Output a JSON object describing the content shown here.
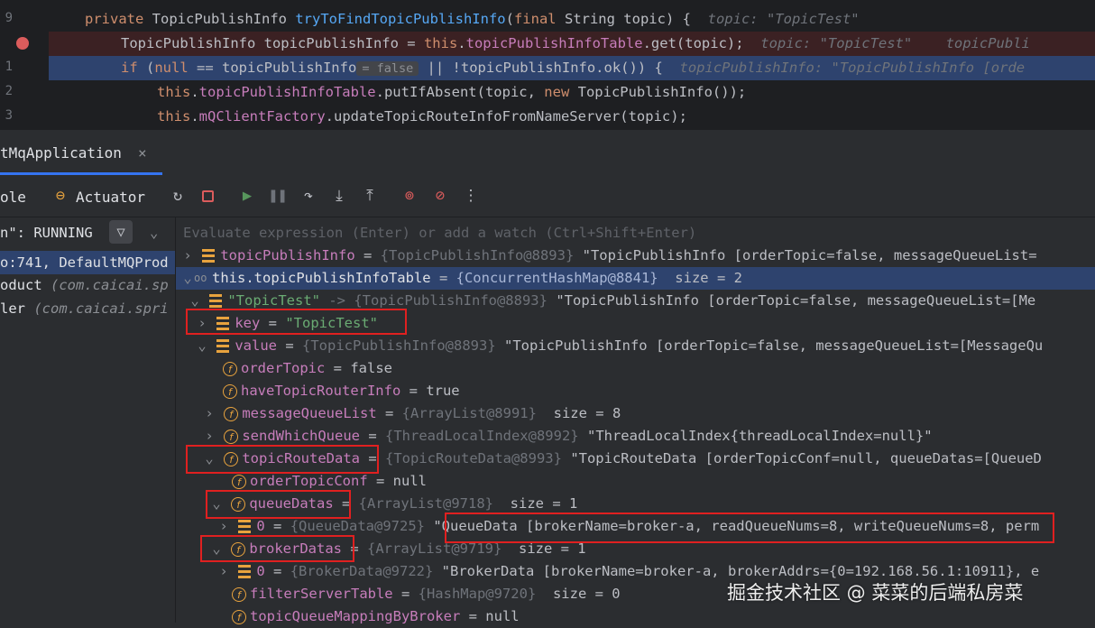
{
  "editor": {
    "line_numbers": [
      "9",
      "",
      "1",
      "2",
      "3"
    ],
    "line1": {
      "kw": "private",
      "type": "TopicPublishInfo",
      "method": "tryToFindTopicPublishInfo",
      "params_kw": "final",
      "params": "String topic) {",
      "hint": "topic: \"TopicTest\""
    },
    "line2": {
      "decl": "TopicPublishInfo topicPublishInfo = ",
      "this_kw": "this",
      "field": "topicPublishInfoTable",
      "call": ".get(topic);",
      "hint1": "topic: \"TopicTest\"",
      "hint2": "topicPubli"
    },
    "line3": {
      "kw": "if",
      "open": " (",
      "null_kw": "null",
      "cmp": " == topicPublishInfo",
      "inlay": "= false",
      "rest": " || !topicPublishInfo.ok()) {",
      "hint": "topicPublishInfo: \"TopicPublishInfo [orde"
    },
    "line4": {
      "this_kw": "this",
      "field": "topicPublishInfoTable",
      "call": ".putIfAbsent(topic, ",
      "new_kw": "new",
      "rest": " TopicPublishInfo());"
    },
    "line5": {
      "this_kw": "this",
      "field": "mQClientFactory",
      "call": ".updateTopicRouteInfoFromNameServer(topic);"
    }
  },
  "run_tab": {
    "label": "tMqApplication",
    "close": "×"
  },
  "toolbar": {
    "console_label": "ole",
    "actuator_label": "Actuator",
    "more": "⋮"
  },
  "frames": {
    "thread_status": "n\": RUNNING",
    "items": [
      {
        "main": "o:741, DefaultMQProd",
        "pkg": ""
      },
      {
        "main": "oduct ",
        "pkg": "(com.caicai.sp"
      },
      {
        "main": "ler ",
        "pkg": "(com.caicai.spri"
      }
    ]
  },
  "watch_placeholder": "Evaluate expression (Enter) or add a watch (Ctrl+Shift+Enter)",
  "variables": [
    {
      "name": "topicPublishInfo",
      "type": "{TopicPublishInfo@8893}",
      "value": "\"TopicPublishInfo [orderTopic=false, messageQueueList="
    },
    {
      "name": "this.topicPublishInfoTable",
      "type": "{ConcurrentHashMap@8841}",
      "value": " size = 2"
    },
    {
      "name": "\"TopicTest\"",
      "type": "-> {TopicPublishInfo@8893}",
      "value": "\"TopicPublishInfo [orderTopic=false, messageQueueList=[Me"
    },
    {
      "name": "key",
      "eq": " = ",
      "value": "\"TopicTest\""
    },
    {
      "name": "value",
      "type": "{TopicPublishInfo@8893}",
      "value": "\"TopicPublishInfo [orderTopic=false, messageQueueList=[MessageQu"
    },
    {
      "name": "orderTopic",
      "value": "false"
    },
    {
      "name": "haveTopicRouterInfo",
      "value": "true"
    },
    {
      "name": "messageQueueList",
      "type": "{ArrayList@8991}",
      "value": " size = 8"
    },
    {
      "name": "sendWhichQueue",
      "type": "{ThreadLocalIndex@8992}",
      "value": "\"ThreadLocalIndex{threadLocalIndex=null}\""
    },
    {
      "name": "topicRouteData",
      "type": "{TopicRouteData@8993}",
      "value": "\"TopicRouteData [orderTopicConf=null, queueDatas=[QueueD"
    },
    {
      "name": "orderTopicConf",
      "value": "null"
    },
    {
      "name": "queueDatas",
      "type": "{ArrayList@9718}",
      "value": " size = 1"
    },
    {
      "name": "0",
      "type": "{QueueData@9725}",
      "value": "\"QueueData [brokerName=broker-a, readQueueNums=8, writeQueueNums=8, perm"
    },
    {
      "name": "brokerDatas",
      "type": "{ArrayList@9719}",
      "value": " size = 1"
    },
    {
      "name": "0",
      "type": "{BrokerData@9722}",
      "value": "\"BrokerData [brokerName=broker-a, brokerAddrs={0=192.168.56.1:10911}, e"
    },
    {
      "name": "filterServerTable",
      "type": "{HashMap@9720}",
      "value": " size = 0"
    },
    {
      "name": "topicQueueMappingByBroker",
      "value": "null"
    }
  ],
  "eq": " = ",
  "watermark": "掘金技术社区 @ 菜菜的后端私房菜",
  "colors": {
    "selection": "#2e436e",
    "highlight_box": "#e02020",
    "field_icon": "#e8a33e",
    "breakpoint": "#db5c5c"
  }
}
